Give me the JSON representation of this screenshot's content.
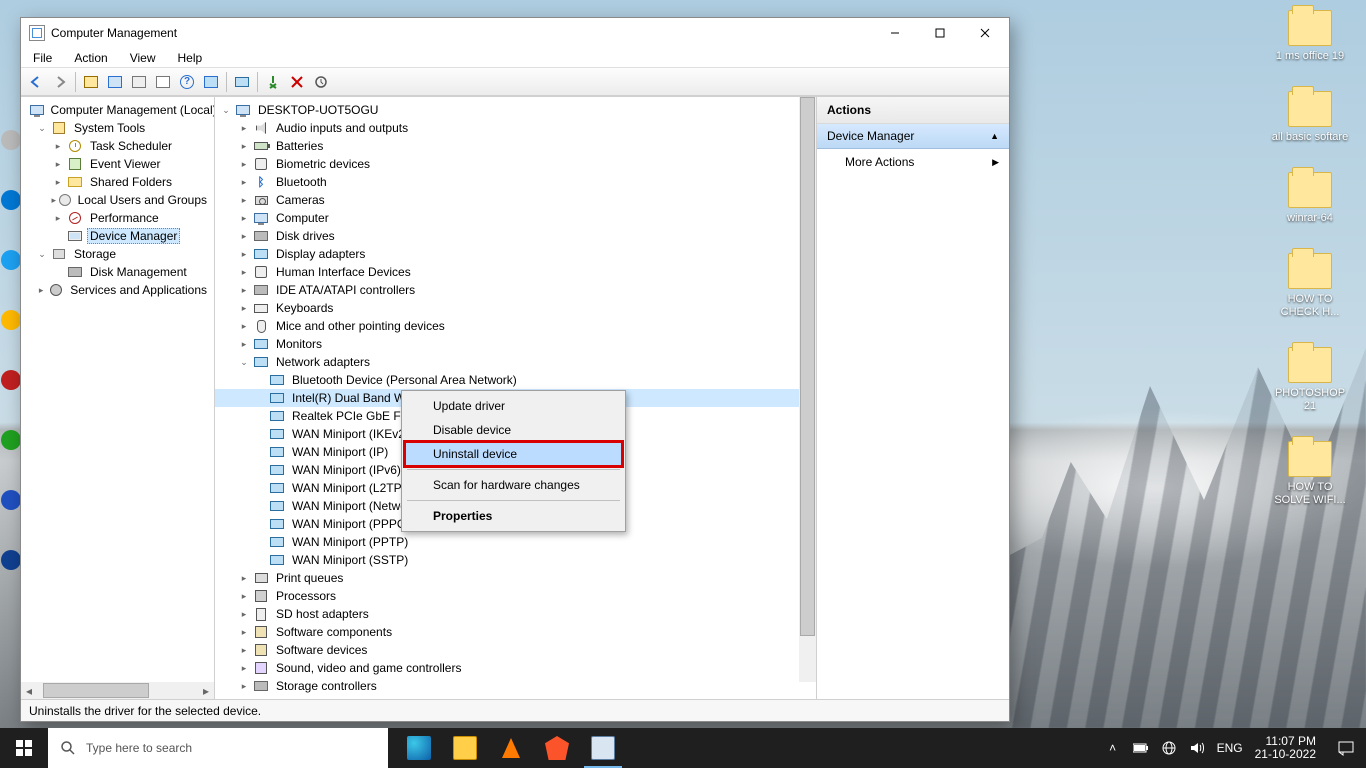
{
  "window": {
    "title": "Computer Management",
    "menus": [
      "File",
      "Action",
      "View",
      "Help"
    ],
    "status": "Uninstalls the driver for the selected device."
  },
  "left_tree": {
    "root": "Computer Management (Local)",
    "system_tools": "System Tools",
    "task_scheduler": "Task Scheduler",
    "event_viewer": "Event Viewer",
    "shared_folders": "Shared Folders",
    "local_users": "Local Users and Groups",
    "performance": "Performance",
    "device_manager": "Device Manager",
    "storage": "Storage",
    "disk_management": "Disk Management",
    "services_apps": "Services and Applications"
  },
  "center_tree": {
    "root": "DESKTOP-UOT5OGU",
    "audio": "Audio inputs and outputs",
    "batteries": "Batteries",
    "biometric": "Biometric devices",
    "bluetooth": "Bluetooth",
    "cameras": "Cameras",
    "computer": "Computer",
    "diskdrives": "Disk drives",
    "display": "Display adapters",
    "hid": "Human Interface Devices",
    "ide": "IDE ATA/ATAPI controllers",
    "keyboards": "Keyboards",
    "mice": "Mice and other pointing devices",
    "monitors": "Monitors",
    "network": "Network adapters",
    "net_items": {
      "btpan": "Bluetooth Device (Personal Area Network)",
      "intel": "Intel(R) Dual Band Wireless-AC 3165",
      "realtek": "Realtek PCIe GbE Family Controller",
      "wan_ikev2": "WAN Miniport (IKEv2)",
      "wan_ip": "WAN Miniport (IP)",
      "wan_ipv6": "WAN Miniport (IPv6)",
      "wan_l2tp": "WAN Miniport (L2TP)",
      "wan_netmon": "WAN Miniport (Network Monitor)",
      "wan_pppoe": "WAN Miniport (PPPOE)",
      "wan_pptp": "WAN Miniport (PPTP)",
      "wan_sstp": "WAN Miniport (SSTP)"
    },
    "printqueues": "Print queues",
    "processors": "Processors",
    "sdhost": "SD host adapters",
    "swcomp": "Software components",
    "swdev": "Software devices",
    "sound": "Sound, video and game controllers",
    "storagectrl": "Storage controllers"
  },
  "actions_pane": {
    "header": "Actions",
    "section": "Device Manager",
    "more": "More Actions"
  },
  "context_menu": {
    "update": "Update driver",
    "disable": "Disable device",
    "uninstall": "Uninstall device",
    "scan": "Scan for hardware changes",
    "properties": "Properties"
  },
  "desktop": {
    "icons": [
      "1 ms office 19",
      "all basic softare",
      "winrar-64",
      "HOW TO CHECK H...",
      "PHOTOSHOP 21",
      "HOW TO SOLVE WIFI..."
    ]
  },
  "taskbar": {
    "search_placeholder": "Type here to search",
    "lang": "ENG",
    "time": "11:07 PM",
    "date": "21-10-2022"
  }
}
